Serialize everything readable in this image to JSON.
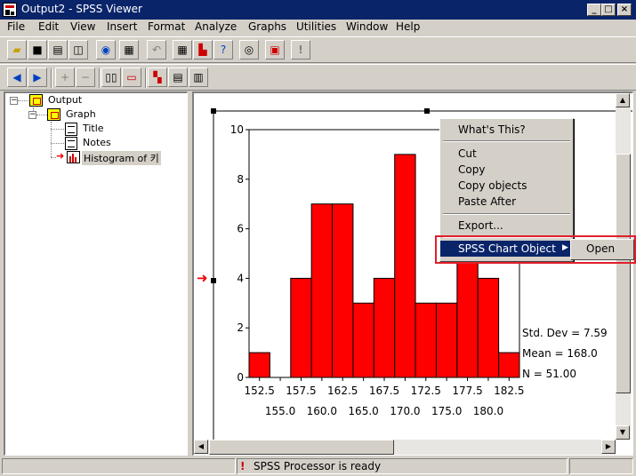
{
  "window": {
    "title": "Output2 - SPSS Viewer",
    "min": "_",
    "max": "□",
    "close": "×"
  },
  "menu": [
    "File",
    "Edit",
    "View",
    "Insert",
    "Format",
    "Analyze",
    "Graphs",
    "Utilities",
    "Window",
    "Help"
  ],
  "outline": {
    "output": "Output",
    "graph": "Graph",
    "title": "Title",
    "notes": "Notes",
    "histogram": "Histogram of 키"
  },
  "context_menu": {
    "whats_this": "What's This?",
    "cut": "Cut",
    "copy": "Copy",
    "copy_objects": "Copy objects",
    "paste_after": "Paste After",
    "export": "Export...",
    "spss_chart_object": "SPSS Chart Object",
    "open": "Open"
  },
  "status": {
    "processor": "SPSS Processor  is ready"
  },
  "stats": {
    "std_dev": "Std. Dev = 7.59",
    "mean": "Mean = 168.0",
    "n": "N = 51.00"
  },
  "colors": {
    "bar_fill": "#ff0000",
    "title_bar": "#0a246a",
    "highlight": "#e0202a"
  },
  "chart_data": {
    "type": "bar",
    "title": "",
    "xlabel": "",
    "ylabel": "",
    "ylim": [
      0,
      10
    ],
    "y_ticks": [
      0,
      2,
      4,
      6,
      8,
      10
    ],
    "bin_width": 2.5,
    "x_ticks_row1": [
      "152.5",
      "157.5",
      "162.5",
      "167.5",
      "172.5",
      "177.5",
      "182.5"
    ],
    "x_ticks_row2": [
      "155.0",
      "160.0",
      "165.0",
      "170.0",
      "175.0",
      "180.0"
    ],
    "categories": [
      152.5,
      155.0,
      157.5,
      160.0,
      162.5,
      165.0,
      167.5,
      170.0,
      172.5,
      175.0,
      177.5,
      180.0,
      182.5
    ],
    "values": [
      1,
      0,
      4,
      7,
      7,
      3,
      4,
      9,
      3,
      3,
      5,
      4,
      1
    ]
  }
}
